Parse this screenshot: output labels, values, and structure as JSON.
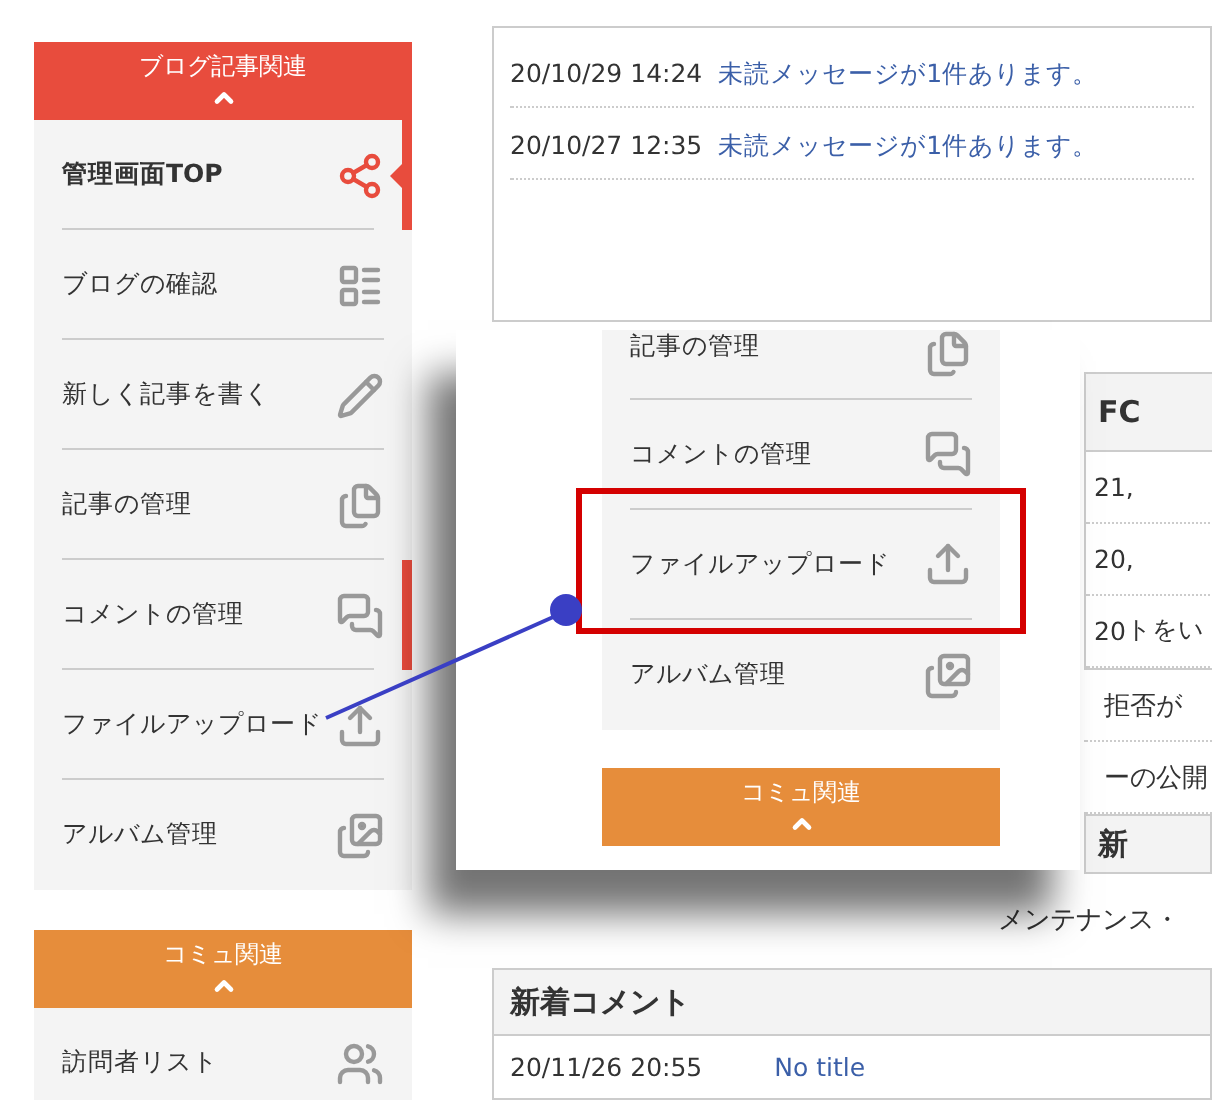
{
  "sidebar": {
    "sections": [
      {
        "title": "ブログ記事関連",
        "color": "#e84c3d",
        "items": [
          {
            "label": "管理画面TOP",
            "selected": true,
            "highlighted": true
          },
          {
            "label": "ブログの確認",
            "selected": false,
            "highlighted": false
          },
          {
            "label": "新しく記事を書く",
            "selected": false,
            "highlighted": false
          },
          {
            "label": "記事の管理",
            "selected": false,
            "highlighted": false
          },
          {
            "label": "コメントの管理",
            "selected": false,
            "highlighted": true
          },
          {
            "label": "ファイルアップロード",
            "selected": false,
            "highlighted": false
          },
          {
            "label": "アルバム管理",
            "selected": false,
            "highlighted": false
          }
        ]
      },
      {
        "title": "コミュ関連",
        "color": "#e68d3b",
        "items": [
          {
            "label": "訪問者リスト",
            "selected": false,
            "highlighted": false
          }
        ]
      }
    ]
  },
  "messages": [
    {
      "time": "20/10/29 14:24",
      "text": "未読メッセージが1件あります。"
    },
    {
      "time": "20/10/27 12:35",
      "text": "未読メッセージが1件あります。"
    }
  ],
  "fc_panel": {
    "title": "FC",
    "rows": [
      [
        "21,"
      ],
      [
        "20,"
      ],
      [
        "20",
        "トをい"
      ]
    ]
  },
  "list_lines": [
    "拒否が",
    "ーの公開"
  ],
  "partial_panel": {
    "title": "新",
    "text": "メンテナンス・"
  },
  "callout": {
    "items": [
      {
        "label": "記事の管理",
        "framed": false
      },
      {
        "label": "コメントの管理",
        "framed": false
      },
      {
        "label": "ファイルアップロード",
        "framed": true
      },
      {
        "label": "アルバム管理",
        "framed": false
      }
    ],
    "section": {
      "title": "コミュ関連",
      "color": "#e68d3b"
    }
  },
  "new_comments": {
    "title": "新着コメント",
    "rows": [
      {
        "time": "20/11/26 20:55",
        "title": "No title"
      }
    ]
  }
}
